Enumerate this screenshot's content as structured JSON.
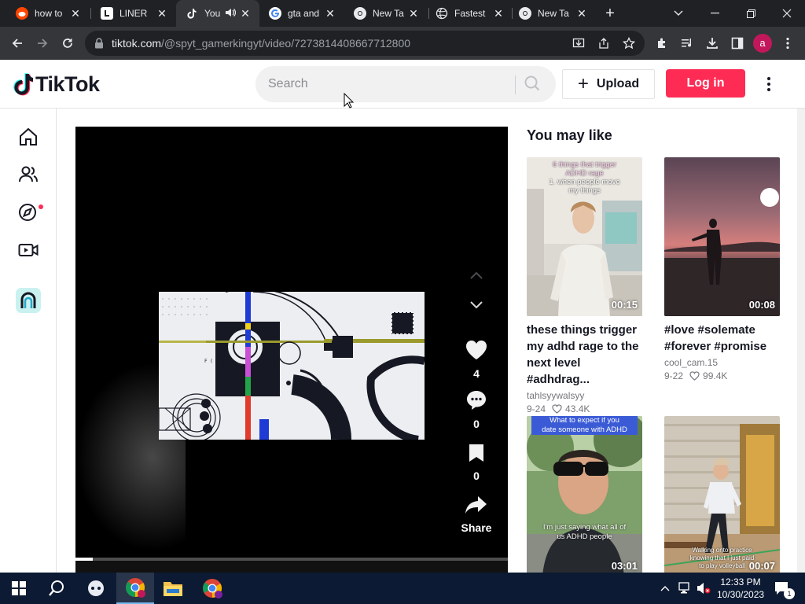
{
  "browser": {
    "tabs": [
      {
        "title": "how to",
        "favicon": "reddit-icon",
        "active": false
      },
      {
        "title": "LINER",
        "favicon": "liner-icon",
        "active": false
      },
      {
        "title": "You",
        "favicon": "tiktok-icon",
        "active": true
      },
      {
        "title": "gta and",
        "favicon": "google-icon",
        "active": false
      },
      {
        "title": "New Ta",
        "favicon": "chrome-icon",
        "active": false
      },
      {
        "title": "Fastest",
        "favicon": "globe-icon",
        "active": false
      },
      {
        "title": "New Ta",
        "favicon": "chrome-icon",
        "active": false
      }
    ],
    "url_host": "tiktok.com",
    "url_path": "/@spyt_gamerkingyt/video/7273814408667712800",
    "profile_initial": "a"
  },
  "tiktok": {
    "logo_text": "TikTok",
    "search_placeholder": "Search",
    "upload_label": "Upload",
    "login_label": "Log in",
    "brand_color": "#fe2c55"
  },
  "player": {
    "likes": "4",
    "comments": "0",
    "saves": "0",
    "share_label": "Share",
    "progress": 0.04
  },
  "you_may_like": {
    "title": "You may like",
    "cards": [
      {
        "title": "these things trigger my adhd rage to the next level #adhdrag...",
        "user": "tahlsyywalsyy",
        "date": "9-24",
        "likes": "43.4K",
        "duration": "00:15",
        "overlay_lines": [
          "6 things that trigger",
          "ADHD rage",
          "1. when people move",
          "my things"
        ]
      },
      {
        "title": "#love #solemate #forever #promise",
        "user": "cool_cam.15",
        "date": "9-22",
        "likes": "99.4K",
        "duration": "00:08",
        "overlay_lines": []
      },
      {
        "title": "",
        "user": "",
        "date": "",
        "likes": "",
        "duration": "03:01",
        "overlay_lines": [
          "What to expect if you",
          "date someone with ADHD",
          "I'm just saying what all of",
          "us ADHD people"
        ]
      },
      {
        "title": "",
        "user": "",
        "date": "",
        "likes": "",
        "duration": "00:07",
        "overlay_lines": [
          "Walking onto practice",
          "knowing that I just paid",
          "to play volleyball"
        ]
      }
    ]
  },
  "taskbar": {
    "time": "12:33 PM",
    "date": "10/30/2023",
    "notification_count": "1"
  }
}
